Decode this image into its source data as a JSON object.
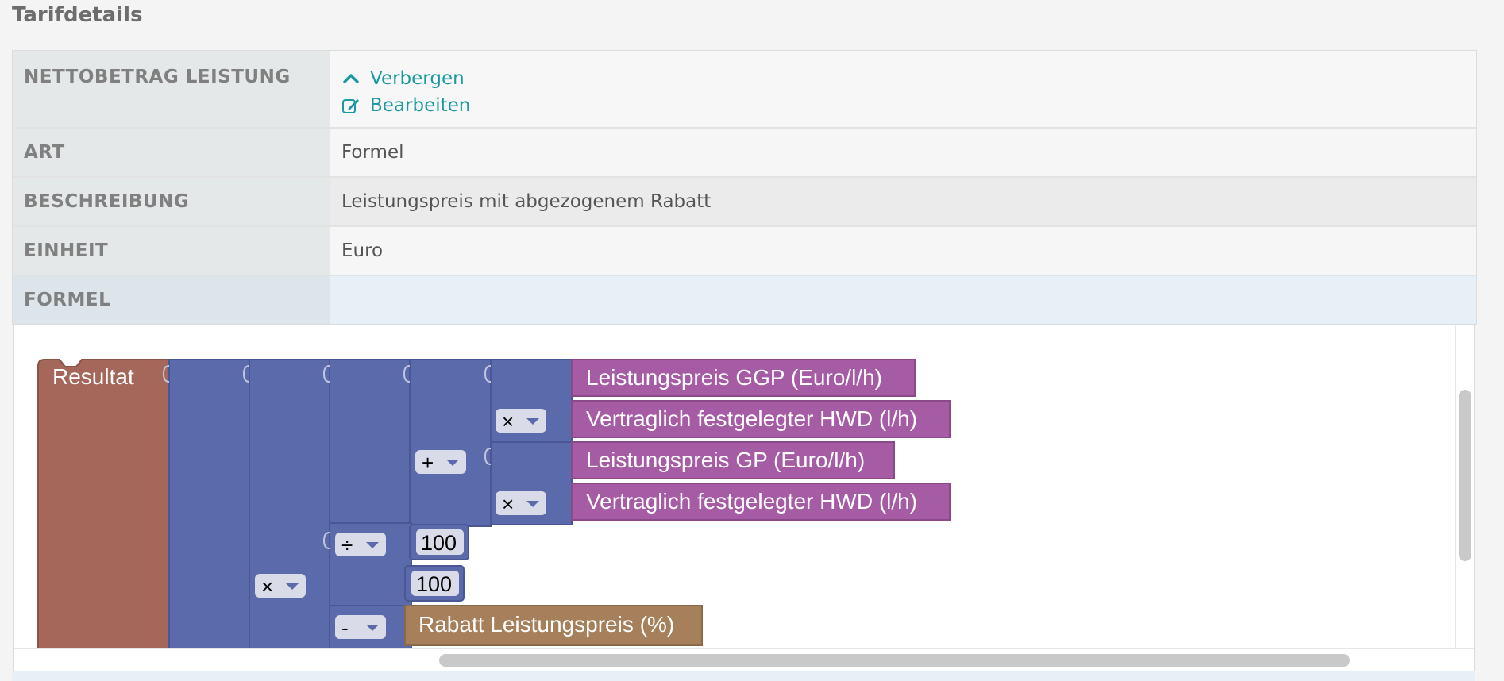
{
  "section_title": "Tarifdetails",
  "rows": {
    "netto": {
      "label": "NETTOBETRAG LEISTUNG",
      "hide_link": "Verbergen",
      "edit_link": "Bearbeiten"
    },
    "art": {
      "label": "ART",
      "value": "Formel"
    },
    "beschreibung": {
      "label": "BESCHREIBUNG",
      "value": "Leistungspreis mit abgezogenem Rabatt"
    },
    "einheit": {
      "label": "EINHEIT",
      "value": "Euro"
    },
    "formel": {
      "label": "FORMEL"
    }
  },
  "formula": {
    "result_label": "Resultat",
    "variables": {
      "v1": "Leistungspreis GGP (Euro/l/h)",
      "v2": "Vertraglich festgelegter HWD (l/h)",
      "v3": "Leistungspreis GP (Euro/l/h)",
      "v4": "Vertraglich festgelegter HWD (l/h)",
      "rabatt": "Rabatt Leistungspreis (%)"
    },
    "operators": {
      "op1": "×",
      "op2": "+",
      "op3": "×",
      "op4": "÷",
      "op5": "×",
      "op6": "-"
    },
    "numbers": {
      "n1": "100",
      "n2": "100"
    }
  },
  "colors": {
    "link": "#1a9aa0",
    "result_block": "#a5675a",
    "math_block": "#5b6aaa",
    "variable_block": "#a55ca5",
    "rabatt_block": "#a5805a"
  },
  "icons": {
    "hide": "chevron-up-icon",
    "edit": "edit-icon",
    "dropdown": "dropdown-arrow-icon"
  }
}
